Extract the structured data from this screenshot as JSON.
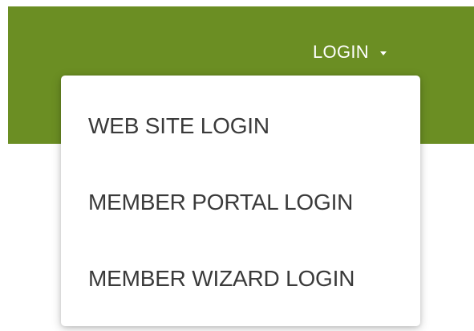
{
  "navbar": {
    "background_color": "#6b8e23",
    "login_label": "LOGIN",
    "caret_icon": "caret-down-icon"
  },
  "dropdown": {
    "items": [
      {
        "label": "WEB SITE LOGIN"
      },
      {
        "label": "MEMBER PORTAL LOGIN"
      },
      {
        "label": "MEMBER WIZARD LOGIN"
      }
    ]
  }
}
